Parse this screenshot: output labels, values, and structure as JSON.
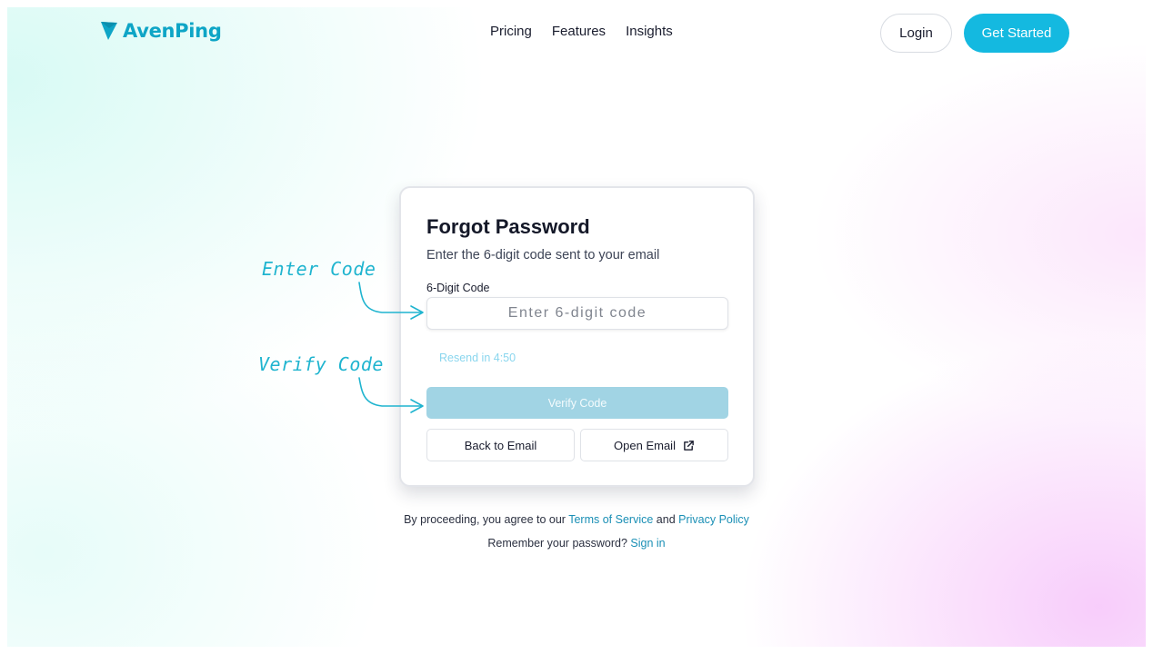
{
  "brand": {
    "name": "AvenPing",
    "color": "#0ea5c6"
  },
  "nav": [
    {
      "label": "Pricing"
    },
    {
      "label": "Features"
    },
    {
      "label": "Insights"
    }
  ],
  "header": {
    "login_label": "Login",
    "get_started_label": "Get Started",
    "accent_color": "#14b9e0"
  },
  "card": {
    "title": "Forgot Password",
    "subtitle": "Enter the 6-digit code sent to your email",
    "code_label": "6-Digit Code",
    "code_placeholder": "Enter 6-digit code",
    "code_value": "",
    "resend_text": "Resend in 4:50",
    "verify_label": "Verify Code",
    "back_label": "Back to Email",
    "open_email_label": "Open Email",
    "open_email_icon": "external-link-icon"
  },
  "footer": {
    "legal_prefix": "By proceeding, you agree to our",
    "terms_label": "Terms of Service",
    "and_text": "and",
    "privacy_label": "Privacy Policy",
    "remember_text": "Remember your password?",
    "sign_in_label": "Sign in"
  },
  "annotations": [
    {
      "label": "Enter Code"
    },
    {
      "label": "Verify Code"
    }
  ]
}
